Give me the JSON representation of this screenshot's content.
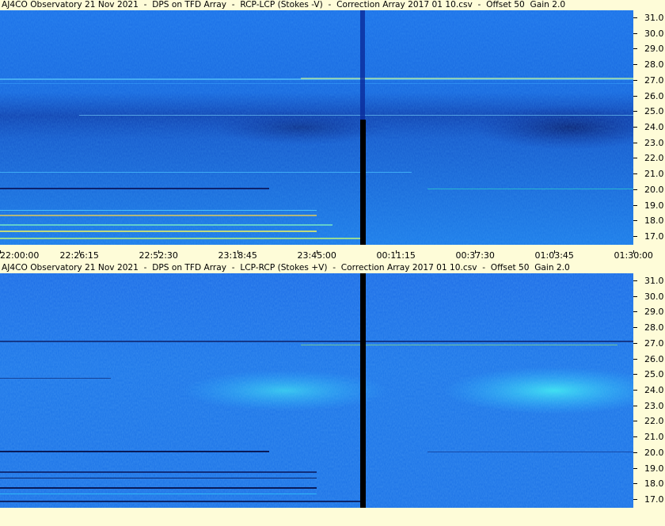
{
  "panels": [
    {
      "title": "AJ4CO Observatory 21 Nov 2021  -  DPS on TFD Array  -  RCP-LCP (Stokes -V)  -  Correction Array 2017 01 10.csv  -  Offset 50  Gain 2.0"
    },
    {
      "title": "AJ4CO Observatory 21 Nov 2021  -  DPS on TFD Array  -  LCP-RCP (Stokes +V)  -  Correction Array 2017 01 10.csv  -  Offset 50  Gain 2.0"
    }
  ],
  "chart_data": {
    "type": "heatmap",
    "y_ticks": [
      "31.0",
      "30.0",
      "29.0",
      "28.0",
      "27.0",
      "26.0",
      "25.0",
      "24.0",
      "23.0",
      "22.0",
      "21.0",
      "20.0",
      "19.0",
      "18.0",
      "17.0"
    ],
    "x_ticks": [
      "22:00:00",
      "22:26:15",
      "22:52:30",
      "23:18:45",
      "23:45:00",
      "00:11:15",
      "00:37:30",
      "01:03:45",
      "01:30:00"
    ],
    "ylim": [
      16.5,
      31.5
    ],
    "colors": {
      "background": "#fefcd8",
      "low": "#0a2a9a",
      "mid": "#1a6ee6",
      "high": "#2fd6ff",
      "gap": "#000000"
    }
  }
}
